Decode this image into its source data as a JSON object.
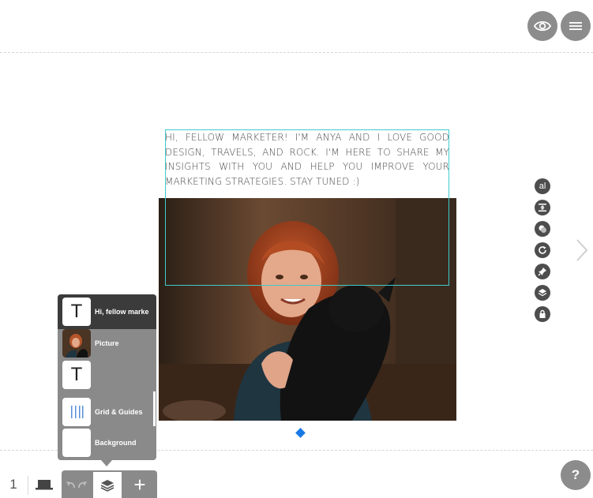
{
  "canvas": {
    "text_block": "Hi, fellow marketer! I'm Anya and I love good design, travels, and rock. I'm here to share my insights with you and help you improve your marketing strategies. Stay tuned :)",
    "accent_color": "#3ecbcb",
    "handle_color": "#1878e6"
  },
  "topbar": {
    "preview_icon": "eye-icon",
    "menu_icon": "hamburger-menu-icon"
  },
  "side_tools": {
    "items": [
      "text-style-icon",
      "align-icon",
      "opacity-icon",
      "rotate-icon",
      "pin-icon",
      "layers-icon",
      "lock-icon"
    ],
    "text_style_glyph": "al"
  },
  "layers": {
    "items": [
      {
        "label": "Hi, fellow marke",
        "thumb": "T",
        "type": "text",
        "selected": true
      },
      {
        "label": "Picture",
        "thumb": "",
        "type": "picture",
        "selected": false
      },
      {
        "label": "",
        "thumb": "T",
        "type": "text",
        "selected": false
      },
      {
        "label": "Grid & Guides",
        "thumb": "|||",
        "type": "grid",
        "selected": false
      },
      {
        "label": "Background",
        "thumb": "",
        "type": "background",
        "selected": false
      }
    ]
  },
  "bottom_bar": {
    "page_number": "1",
    "device_icon": "laptop-icon",
    "undo_redo_icon": "undo-redo-icon",
    "layers_icon": "layers-icon",
    "add_label": "+"
  },
  "help": {
    "label": "?"
  }
}
